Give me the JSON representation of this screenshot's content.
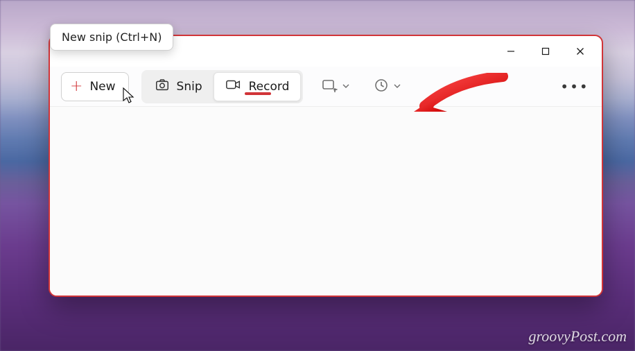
{
  "tooltip_text": "New snip (Ctrl+N)",
  "toolbar": {
    "new_label": "New",
    "snip_label": "Snip",
    "record_label": "Record"
  },
  "watermark": "groovyPost.com",
  "colors": {
    "accent_red": "#d13438"
  }
}
